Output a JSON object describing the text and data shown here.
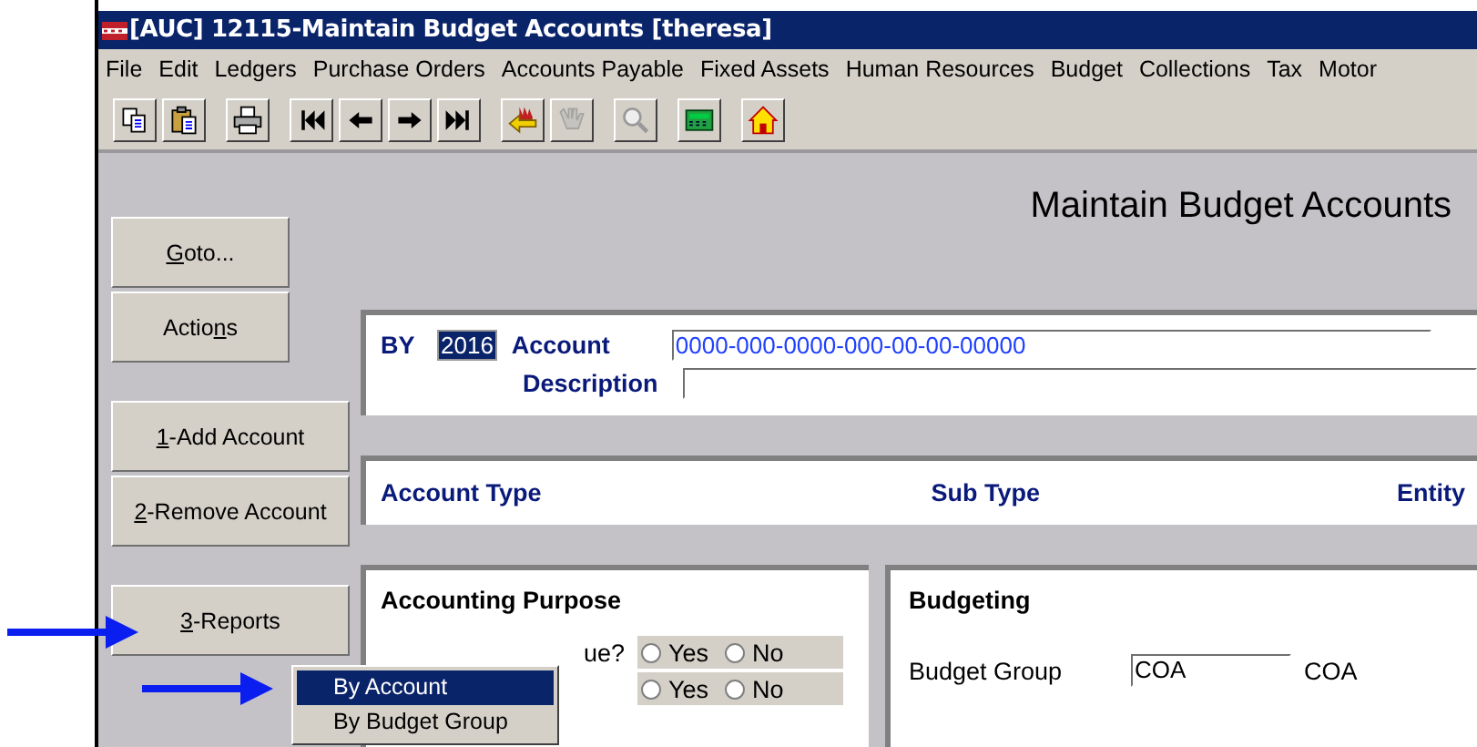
{
  "window": {
    "title": "[AUC] 12115-Maintain Budget Accounts [theresa]"
  },
  "menu": [
    "File",
    "Edit",
    "Ledgers",
    "Purchase Orders",
    "Accounts Payable",
    "Fixed Assets",
    "Human Resources",
    "Budget",
    "Collections",
    "Tax",
    "Motor"
  ],
  "toolbar": [
    [
      {
        "kind": "copy",
        "disabled": false
      },
      {
        "kind": "paste",
        "disabled": false
      }
    ],
    [
      {
        "kind": "print",
        "disabled": false
      }
    ],
    [
      {
        "kind": "first",
        "disabled": false
      },
      {
        "kind": "prev",
        "disabled": false
      },
      {
        "kind": "next",
        "disabled": false
      },
      {
        "kind": "last",
        "disabled": false
      }
    ],
    [
      {
        "kind": "exit",
        "disabled": false
      },
      {
        "kind": "hand",
        "disabled": true
      }
    ],
    [
      {
        "kind": "search",
        "disabled": false
      }
    ],
    [
      {
        "kind": "calculator",
        "disabled": false
      }
    ],
    [
      {
        "kind": "home",
        "disabled": false
      }
    ]
  ],
  "heading": "Maintain Budget Accounts",
  "side_buttons": [
    [
      {
        "key": "G",
        "suffix": "oto..."
      },
      {
        "prefix": "Actio",
        "key": "n",
        "suffix": "s"
      }
    ],
    [
      {
        "key": "1",
        "suffix": "-Add Account"
      },
      {
        "key": "2",
        "suffix": "-Remove Account"
      }
    ],
    [
      {
        "key": "3",
        "suffix": "-Reports"
      }
    ]
  ],
  "account": {
    "by_label": "BY",
    "year": "2016",
    "account_label": "Account",
    "account_value": "0000-000-0000-000-00-00-00000",
    "description_label": "Description"
  },
  "type_header": [
    "Account Type",
    "Sub Type",
    "Entity"
  ],
  "accounting_purpose": {
    "title": "Accounting Purpose",
    "rows": [
      {
        "label": "ue?",
        "options": [
          {
            "label": "Yes",
            "selected": false
          },
          {
            "label": "No",
            "selected": false
          }
        ]
      },
      {
        "options": [
          {
            "label": "Yes",
            "selected": false
          },
          {
            "label": "No",
            "selected": false
          }
        ]
      }
    ]
  },
  "budgeting": {
    "title": "Budgeting",
    "group_label": "Budget Group",
    "group_value": "COA",
    "group_description": "COA"
  },
  "popup_menu": [
    {
      "label": "By Account",
      "selected": true
    },
    {
      "label": "By Budget Group",
      "selected": false
    }
  ]
}
